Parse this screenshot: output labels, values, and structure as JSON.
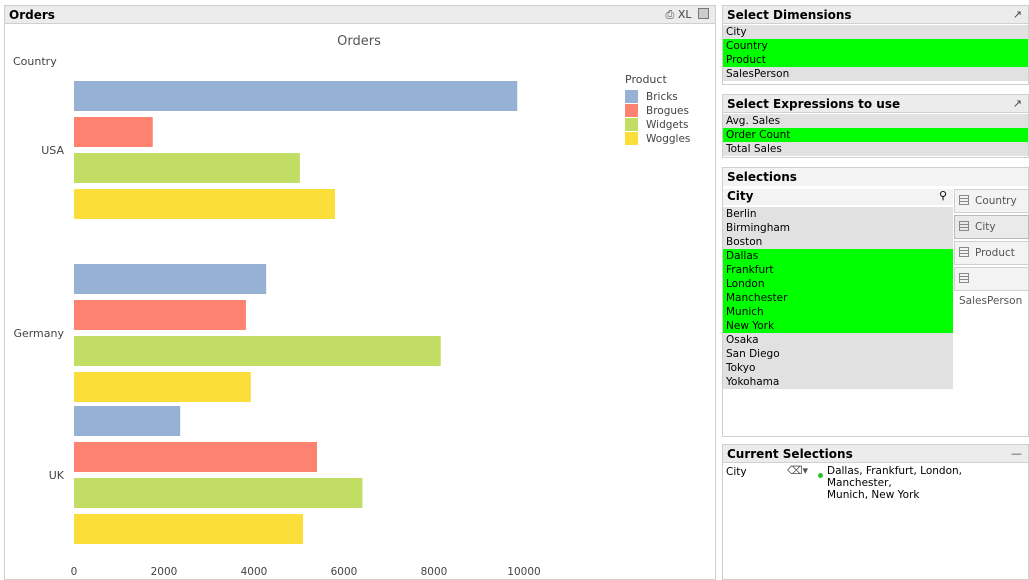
{
  "orders": {
    "caption": "Orders",
    "caption_controls": "⎙ XL",
    "chart_title": "Orders",
    "dimension_label": "Country",
    "legend_title": "Product"
  },
  "chart_data": {
    "type": "bar",
    "orientation": "horizontal",
    "title": "Orders",
    "xlabel": "",
    "ylabel": "Country",
    "categories": [
      "USA",
      "Germany",
      "UK"
    ],
    "series": [
      {
        "name": "Bricks",
        "color": "#96b1d3",
        "values": [
          9850,
          4270,
          2360
        ]
      },
      {
        "name": "Brogues",
        "color": "#fd8270",
        "values": [
          1750,
          3820,
          5400
        ]
      },
      {
        "name": "Widgets",
        "color": "#c2dd63",
        "values": [
          5020,
          8150,
          6410
        ]
      },
      {
        "name": "Woggles",
        "color": "#fcde3b",
        "values": [
          5800,
          3930,
          5090
        ]
      }
    ],
    "xlim": [
      0,
      10000
    ],
    "xticks": [
      "0",
      "2000",
      "4000",
      "6000",
      "8000",
      "10000"
    ],
    "grid": false,
    "legend_position": "top-right"
  },
  "select_dimensions": {
    "caption": "Select Dimensions",
    "items": [
      {
        "label": "City",
        "selected": false
      },
      {
        "label": "Country",
        "selected": true
      },
      {
        "label": "Product",
        "selected": true
      },
      {
        "label": "SalesPerson",
        "selected": false
      }
    ]
  },
  "select_expressions": {
    "caption": "Select Expressions to use",
    "items": [
      {
        "label": "Avg. Sales",
        "selected": false
      },
      {
        "label": "Order Count",
        "selected": true
      },
      {
        "label": "Total Sales",
        "selected": false
      }
    ]
  },
  "selections": {
    "caption": "Selections",
    "listbox_title": "City",
    "cities": [
      {
        "label": "Berlin",
        "selected": false
      },
      {
        "label": "Birmingham",
        "selected": false
      },
      {
        "label": "Boston",
        "selected": false
      },
      {
        "label": "Dallas",
        "selected": true
      },
      {
        "label": "Frankfurt",
        "selected": true
      },
      {
        "label": "London",
        "selected": true
      },
      {
        "label": "Manchester",
        "selected": true
      },
      {
        "label": "Munich",
        "selected": true
      },
      {
        "label": "New York",
        "selected": true
      },
      {
        "label": "Osaka",
        "selected": false
      },
      {
        "label": "San Diego",
        "selected": false
      },
      {
        "label": "Tokyo",
        "selected": false
      },
      {
        "label": "Yokohama",
        "selected": false
      }
    ],
    "tabs": [
      "Country",
      "City",
      "Product",
      "SalesPerson"
    ],
    "active_tab": "City"
  },
  "current_selections": {
    "caption": "Current Selections",
    "field": "City",
    "values_line1": "Dallas, Frankfurt, London, Manchester,",
    "values_line2": "Munich, New York"
  },
  "colors": {
    "selected": "#00ff00",
    "caption_bg": "#ececec",
    "row_bg": "#e1e1e1"
  }
}
